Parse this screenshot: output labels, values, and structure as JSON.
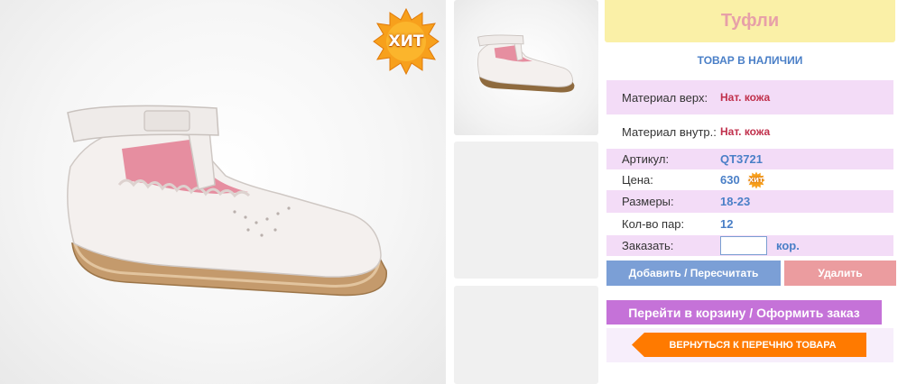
{
  "product": {
    "title": "Туфли",
    "availability": "ТОВАР В НАЛИЧИИ",
    "hit_badge": "ХИТ",
    "mini_hit_badge": "ХИТ"
  },
  "specs": {
    "material_top_label": "Материал верх:",
    "material_top_value": "Нат. кожа",
    "material_inner_label": "Материал внутр.:",
    "material_inner_value": "Нат. кожа",
    "article_label": "Артикул:",
    "article_value": "QT3721",
    "price_label": "Цена:",
    "price_value": "630",
    "sizes_label": "Размеры:",
    "sizes_value": "18-23",
    "pairs_label": "Кол-во пар:",
    "pairs_value": "12",
    "order_label": "Заказать:",
    "order_value": "",
    "order_unit": "кор."
  },
  "actions": {
    "add_label": "Добавить / Пересчитать",
    "delete_label": "Удалить",
    "cart_label": "Перейти в корзину / Оформить заказ",
    "back_label": "ВЕРНУТЬСЯ К ПЕРЕЧНЮ ТОВАРА"
  },
  "colors": {
    "accent_blue": "#4a7fc7",
    "title_bg": "#faf0a7",
    "row_lilac": "#f3dcf7",
    "add_button": "#7b9fd6",
    "delete_button": "#eb9c9f",
    "cart_button": "#c572d8",
    "back_button": "#ff7a00"
  },
  "icons": {
    "hit": "starburst-badge-icon",
    "product_photo": "white-tstrap-shoe-image"
  }
}
